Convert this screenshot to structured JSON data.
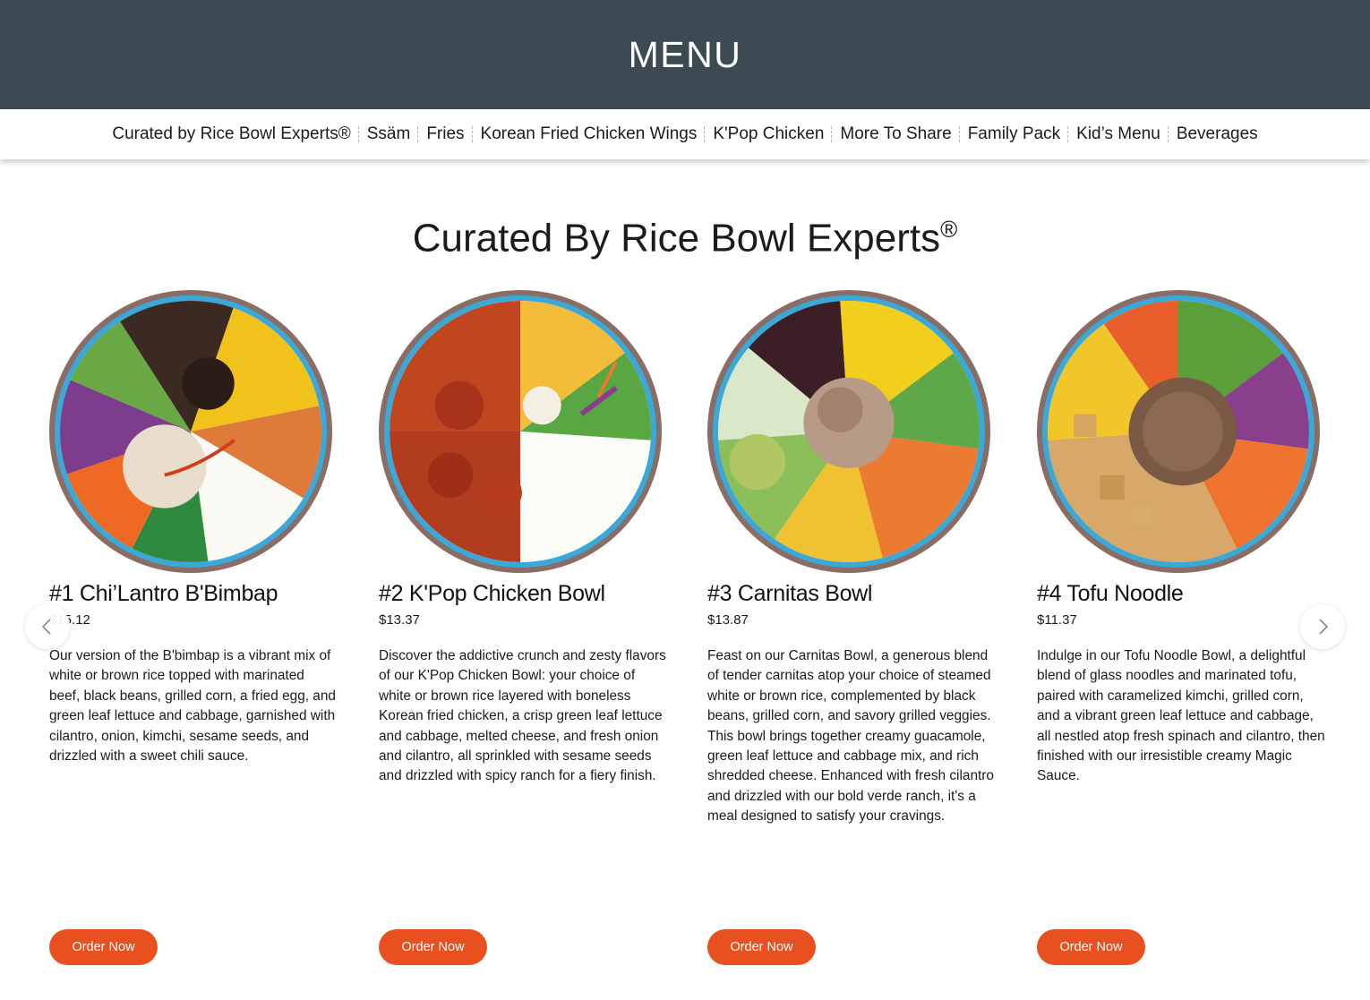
{
  "header": {
    "title": "MENU"
  },
  "nav": {
    "items": [
      {
        "label": "Curated by Rice Bowl Experts®"
      },
      {
        "label": "Ssäm"
      },
      {
        "label": "Fries"
      },
      {
        "label": "Korean Fried Chicken Wings"
      },
      {
        "label": "K'Pop Chicken"
      },
      {
        "label": "More To Share"
      },
      {
        "label": "Family Pack"
      },
      {
        "label": "Kid’s Menu"
      },
      {
        "label": "Beverages"
      }
    ]
  },
  "section": {
    "title": "Curated By Rice Bowl Experts",
    "title_mark": "®"
  },
  "carousel": {
    "prev_icon": "chevron-left-icon",
    "next_icon": "chevron-right-icon",
    "items": [
      {
        "name": "#1 Chi’Lantro B'Bimbap",
        "price": "$15.12",
        "description": "Our version of the B'bimbap is a vibrant mix of white or brown rice topped with marinated beef, black beans, grilled corn, a fried egg, and green leaf lettuce and cabbage, garnished with cilantro, onion, kimchi, sesame seeds, and drizzled with a sweet chili sauce.",
        "button": "Order Now"
      },
      {
        "name": "#2 K'Pop Chicken Bowl",
        "price": "$13.37",
        "description": "Discover the addictive crunch and zesty flavors of our K'Pop Chicken Bowl: your choice of white or brown rice layered with boneless Korean fried chicken, a crisp green leaf lettuce and cabbage, melted cheese, and fresh onion and cilantro, all sprinkled with sesame seeds and drizzled with spicy ranch for a fiery finish.",
        "button": "Order Now"
      },
      {
        "name": "#3 Carnitas Bowl",
        "price": "$13.87",
        "description": "Feast on our Carnitas Bowl, a generous blend of tender carnitas atop your choice of steamed white or brown rice, complemented by black beans, grilled corn, and savory grilled veggies. This bowl brings together creamy guacamole, green leaf lettuce and cabbage mix, and rich shredded cheese. Enhanced with fresh cilantro and drizzled with our bold verde ranch, it's a meal designed to satisfy your cravings.",
        "button": "Order Now"
      },
      {
        "name": "#4 Tofu Noodle",
        "price": "$11.37",
        "description": "Indulge in our Tofu Noodle Bowl, a delightful blend of glass noodles and marinated tofu, paired with caramelized kimchi, grilled corn, and a vibrant green leaf lettuce and cabbage, all nestled atop fresh spinach and cilantro, then finished with our irresistible creamy Magic Sauce.",
        "button": "Order Now"
      }
    ]
  },
  "colors": {
    "header_bg": "#3c4a53",
    "accent": "#e9501f",
    "text": "#1b1b1b"
  }
}
